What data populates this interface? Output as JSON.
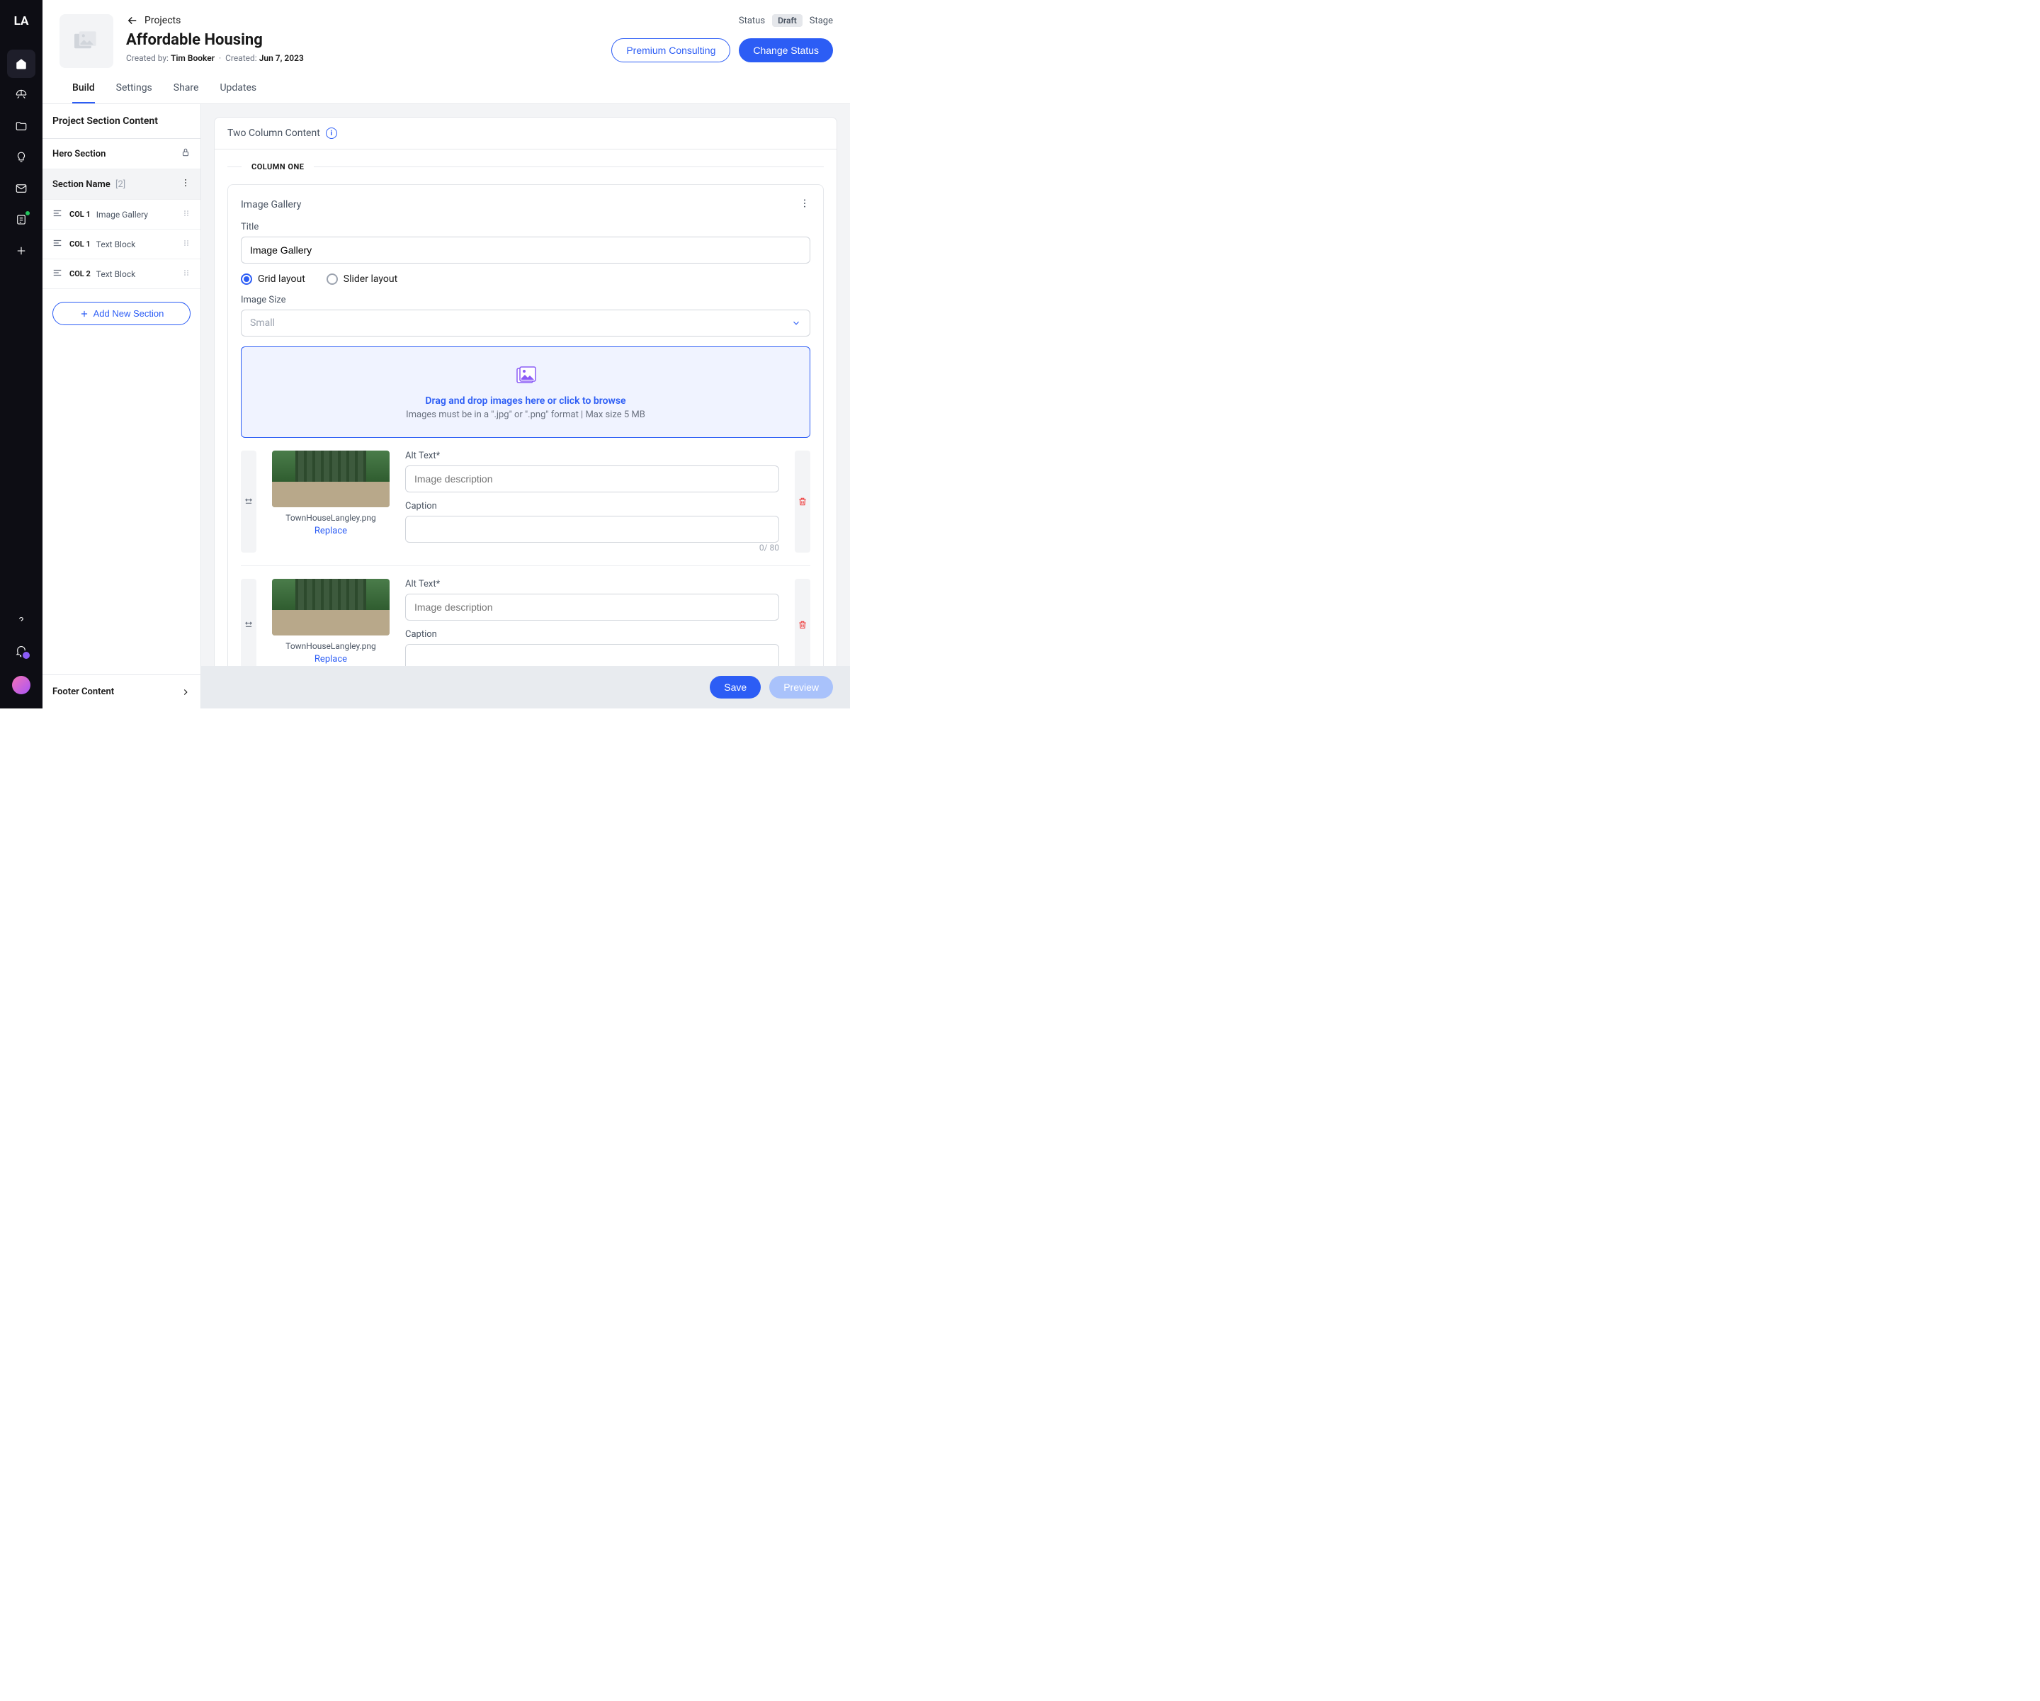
{
  "logo": "LA",
  "breadcrumb": "Projects",
  "project": {
    "title": "Affordable Housing",
    "created_by_label": "Created by:",
    "created_by": "Tim Booker",
    "created_label": "Created:",
    "created_date": "Jun 7, 2023"
  },
  "header_status": {
    "status_label": "Status",
    "status_value": "Draft",
    "stage_label": "Stage"
  },
  "buttons": {
    "premium": "Premium Consulting",
    "change_status": "Change Status",
    "save": "Save",
    "preview": "Preview"
  },
  "tabs": [
    "Build",
    "Settings",
    "Share",
    "Updates"
  ],
  "panel": {
    "title": "Project Section Content",
    "hero": "Hero Section",
    "section_name_label": "Section Name",
    "section_count": "[2]",
    "items": [
      {
        "col": "COL 1",
        "type": "Image Gallery"
      },
      {
        "col": "COL 1",
        "type": "Text Block"
      },
      {
        "col": "COL 2",
        "type": "Text Block"
      }
    ],
    "add": "Add New Section",
    "footer": "Footer Content"
  },
  "content": {
    "card_title": "Two Column Content",
    "column_label": "COLUMN ONE",
    "widget_title": "Image Gallery",
    "field_title": "Title",
    "title_value": "Image Gallery",
    "layout_grid": "Grid layout",
    "layout_slider": "Slider layout",
    "image_size_label": "Image Size",
    "image_size_value": "Small",
    "dropzone_text": "Drag and drop images here or click to browse",
    "dropzone_hint": "Images must be in a \".jpg\" or \".png\" format | Max size 5 MB",
    "alt_label": "Alt Text*",
    "alt_placeholder": "Image description",
    "caption_label": "Caption",
    "counter": "0/ 80",
    "replace": "Replace",
    "images": [
      {
        "filename": "TownHouseLangley.png"
      },
      {
        "filename": "TownHouseLangley.png"
      }
    ]
  }
}
